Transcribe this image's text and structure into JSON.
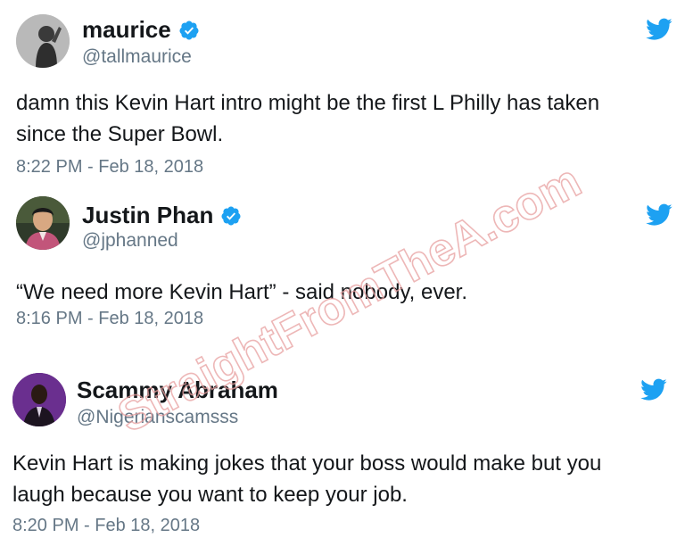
{
  "tweets": [
    {
      "display_name": "maurice",
      "verified": true,
      "handle": "@tallmaurice",
      "text_lines": [
        "damn this Kevin Hart intro might be the first L Philly has taken",
        "since the Super Bowl."
      ],
      "timestamp": "8:22 PM - Feb 18, 2018",
      "avatar_icon": "grayscale-photo-avatar"
    },
    {
      "display_name": "Justin Phan",
      "verified": true,
      "handle": "@jphanned",
      "text_lines": [
        "“We need more Kevin Hart” - said nobody, ever."
      ],
      "timestamp": "8:16 PM - Feb 18, 2018",
      "avatar_icon": "portrait-photo-avatar"
    },
    {
      "display_name": "Scammy Abraham",
      "verified": false,
      "handle": "@Nigerianscamsss",
      "text_lines": [
        "Kevin Hart is making jokes that your boss would make but you",
        "laugh because you want to keep your job."
      ],
      "timestamp": "8:20 PM - Feb 18, 2018",
      "avatar_icon": "purple-photo-avatar"
    }
  ],
  "watermark": "StraightFromTheA.com",
  "colors": {
    "twitter_blue": "#1da1f2",
    "verified_blue": "#1da1f2",
    "secondary_text": "#657786",
    "primary_text": "#14171a",
    "watermark": "#e8a0a0"
  }
}
